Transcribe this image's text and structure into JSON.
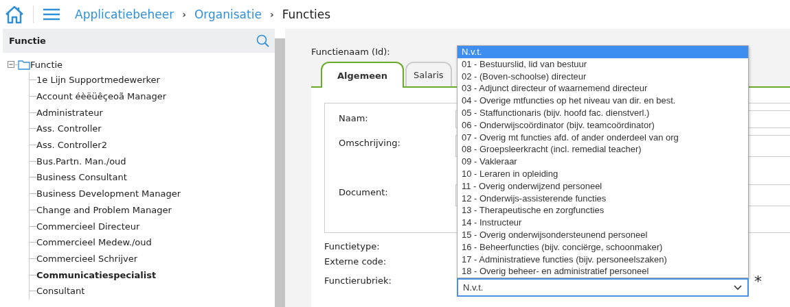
{
  "breadcrumb": [
    "Applicatiebeheer",
    "Organisatie",
    "Functies"
  ],
  "breadcrumb_separator": "›",
  "tree": {
    "title": "Functie",
    "root": {
      "label": "Functie",
      "expanded": true,
      "children": [
        {
          "label": "1e Lijn Supportmedewerker",
          "selected": false
        },
        {
          "label": "Account éèëüêçeoã Manager",
          "selected": false
        },
        {
          "label": "Administrateur",
          "selected": false
        },
        {
          "label": "Ass. Controller",
          "selected": false
        },
        {
          "label": "Ass. Controller2",
          "selected": false
        },
        {
          "label": "Bus.Partn. Man./oud",
          "selected": false
        },
        {
          "label": "Business Consultant",
          "selected": false
        },
        {
          "label": "Business Development Manager",
          "selected": false
        },
        {
          "label": "Change and Problem Manager",
          "selected": false
        },
        {
          "label": "Commercieel Directeur",
          "selected": false
        },
        {
          "label": "Commercieel Medew./oud",
          "selected": false
        },
        {
          "label": "Commercieel Schrijver",
          "selected": false
        },
        {
          "label": "Communicatiespecialist",
          "selected": true
        },
        {
          "label": "Consultant",
          "selected": false
        }
      ]
    }
  },
  "form": {
    "title": "Functienaam (Id):",
    "tabs": [
      {
        "label": "Algemeen",
        "selected": true
      },
      {
        "label": "Salaris",
        "selected": false
      }
    ],
    "box_fields": [
      {
        "label": "Naam:",
        "kind": "input"
      },
      {
        "label": "Omschrijving:",
        "kind": "textarea"
      },
      {
        "label": "Document:",
        "kind": "document"
      }
    ],
    "fields": [
      {
        "label": "Functietype:"
      },
      {
        "label": "Externe code:"
      }
    ],
    "rubriek": {
      "label": "Functierubriek:",
      "value": "N.v.t.",
      "required_mark": "*",
      "open": true,
      "options": [
        {
          "label": "N.v.t.",
          "selected": true
        },
        {
          "label": "01 - Bestuurslid, lid van bestuur",
          "selected": false
        },
        {
          "label": "02 - (Boven-schoolse) directeur",
          "selected": false
        },
        {
          "label": "03 - Adjunct directeur of waarnemend directeur",
          "selected": false
        },
        {
          "label": "04 - Overige mtfuncties op het niveau van dir. en best.",
          "selected": false
        },
        {
          "label": "05 - Staffunctionaris (bijv. hoofd fac. dienstverl.)",
          "selected": false
        },
        {
          "label": "06 - Onderwijscoördinator (bijv. teamcoördinator)",
          "selected": false
        },
        {
          "label": "07 - Overig mt functies afd. of ander onderdeel van org",
          "selected": false
        },
        {
          "label": "08 - Groepsleerkracht (incl. remedial teacher)",
          "selected": false
        },
        {
          "label": "09 - Vakleraar",
          "selected": false
        },
        {
          "label": "10 - Leraren in opleiding",
          "selected": false
        },
        {
          "label": "11 - Overig onderwijzend personeel",
          "selected": false
        },
        {
          "label": "12 - Onderwijs-assisterende functies",
          "selected": false
        },
        {
          "label": "13 - Therapeutische en zorgfuncties",
          "selected": false
        },
        {
          "label": "14 - Instructeur",
          "selected": false
        },
        {
          "label": "15 - Overig onderwijsondersteunend personeel",
          "selected": false
        },
        {
          "label": "16 - Beheerfuncties (bijv. conciërge, schoonmaker)",
          "selected": false
        },
        {
          "label": "17 - Administratieve functies (bijv. personeelszaken)",
          "selected": false
        },
        {
          "label": "18 - Overig beheer- en administratief personeel",
          "selected": false
        }
      ]
    }
  }
}
